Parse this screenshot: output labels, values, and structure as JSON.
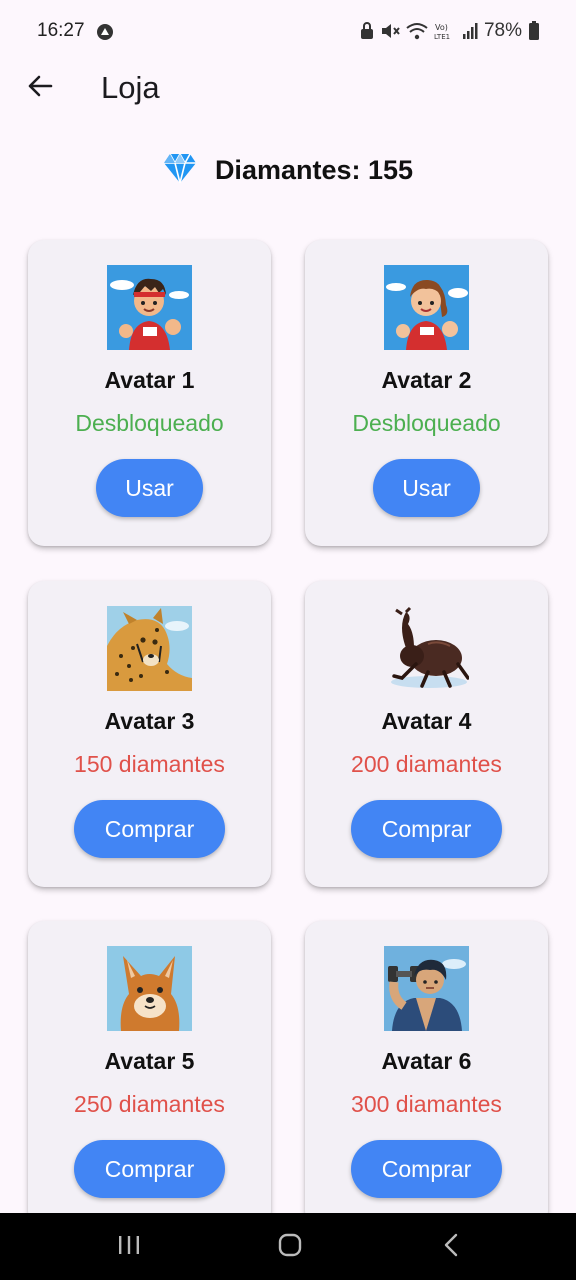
{
  "status_bar": {
    "time": "16:27",
    "battery": "78%"
  },
  "app_bar": {
    "title": "Loja",
    "back_icon": "arrow-left-icon"
  },
  "balance": {
    "icon": "diamond-icon",
    "label": "Diamantes: 155"
  },
  "colors": {
    "primary_button": "#4285f4",
    "unlocked": "#4caf50",
    "price": "#e0514a",
    "card_bg": "#f3f0f6"
  },
  "cards": [
    {
      "name": "Avatar 1",
      "status": "Desbloqueado",
      "button": "Usar"
    },
    {
      "name": "Avatar 2",
      "status": "Desbloqueado",
      "button": "Usar"
    },
    {
      "name": "Avatar 3",
      "status": "150 diamantes",
      "button": "Comprar"
    },
    {
      "name": "Avatar 4",
      "status": "200 diamantes",
      "button": "Comprar"
    },
    {
      "name": "Avatar 5",
      "status": "250 diamantes",
      "button": "Comprar"
    },
    {
      "name": "Avatar 6",
      "status": "300 diamantes",
      "button": "Comprar"
    }
  ],
  "nav_bar": {
    "recents_icon": "recent-apps-icon",
    "home_icon": "home-icon",
    "back_icon": "nav-back-icon"
  }
}
